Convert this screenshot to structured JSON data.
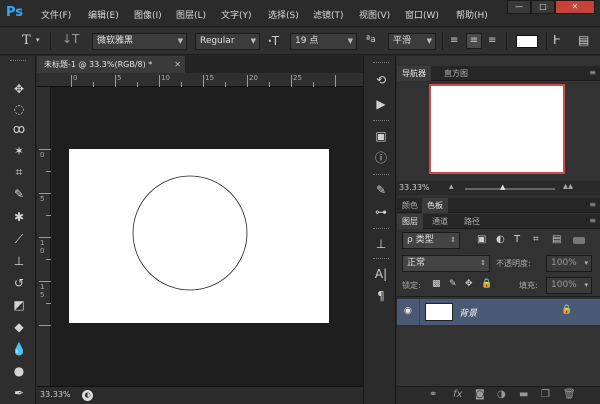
{
  "app": {
    "logo": "Ps"
  },
  "menu": [
    "文件(F)",
    "编辑(E)",
    "图像(I)",
    "图层(L)",
    "文字(Y)",
    "选择(S)",
    "滤镜(T)",
    "视图(V)",
    "窗口(W)",
    "帮助(H)"
  ],
  "window_controls": {
    "minimize": "—",
    "maximize": "□",
    "close": "✕"
  },
  "options": {
    "text_tool_glyph": "T",
    "font_family": "微软雅黑",
    "font_style": "Regular",
    "font_size": "19 点",
    "antialias_label": "ªa",
    "antialias": "平滑"
  },
  "document": {
    "tab_title": "未标题-1 @ 33.3%(RGB/8) *",
    "zoom_status": "33.33%",
    "ruler_h_labels": [
      "0",
      "5",
      "10",
      "15",
      "20",
      "25"
    ],
    "ruler_v_labels": [
      "0",
      "5",
      "1\n0",
      "1\n5"
    ]
  },
  "navigator": {
    "tabs": [
      "导航器",
      "直方图"
    ],
    "zoom": "33.33%"
  },
  "color_panel": {
    "tabs": [
      "颜色",
      "色板"
    ]
  },
  "layers": {
    "tabs": [
      "图层",
      "通道",
      "路径"
    ],
    "filter_kind": "ρ 类型",
    "blend_mode": "正常",
    "opacity_label": "不透明度:",
    "opacity_value": "100%",
    "lock_label": "锁定:",
    "fill_label": "填充:",
    "fill_value": "100%",
    "items": [
      {
        "name": "背景"
      }
    ]
  },
  "colors": {
    "accent": "#31a8ff",
    "selection_row": "#4b5a74",
    "nav_frame": "#d14b4b"
  }
}
